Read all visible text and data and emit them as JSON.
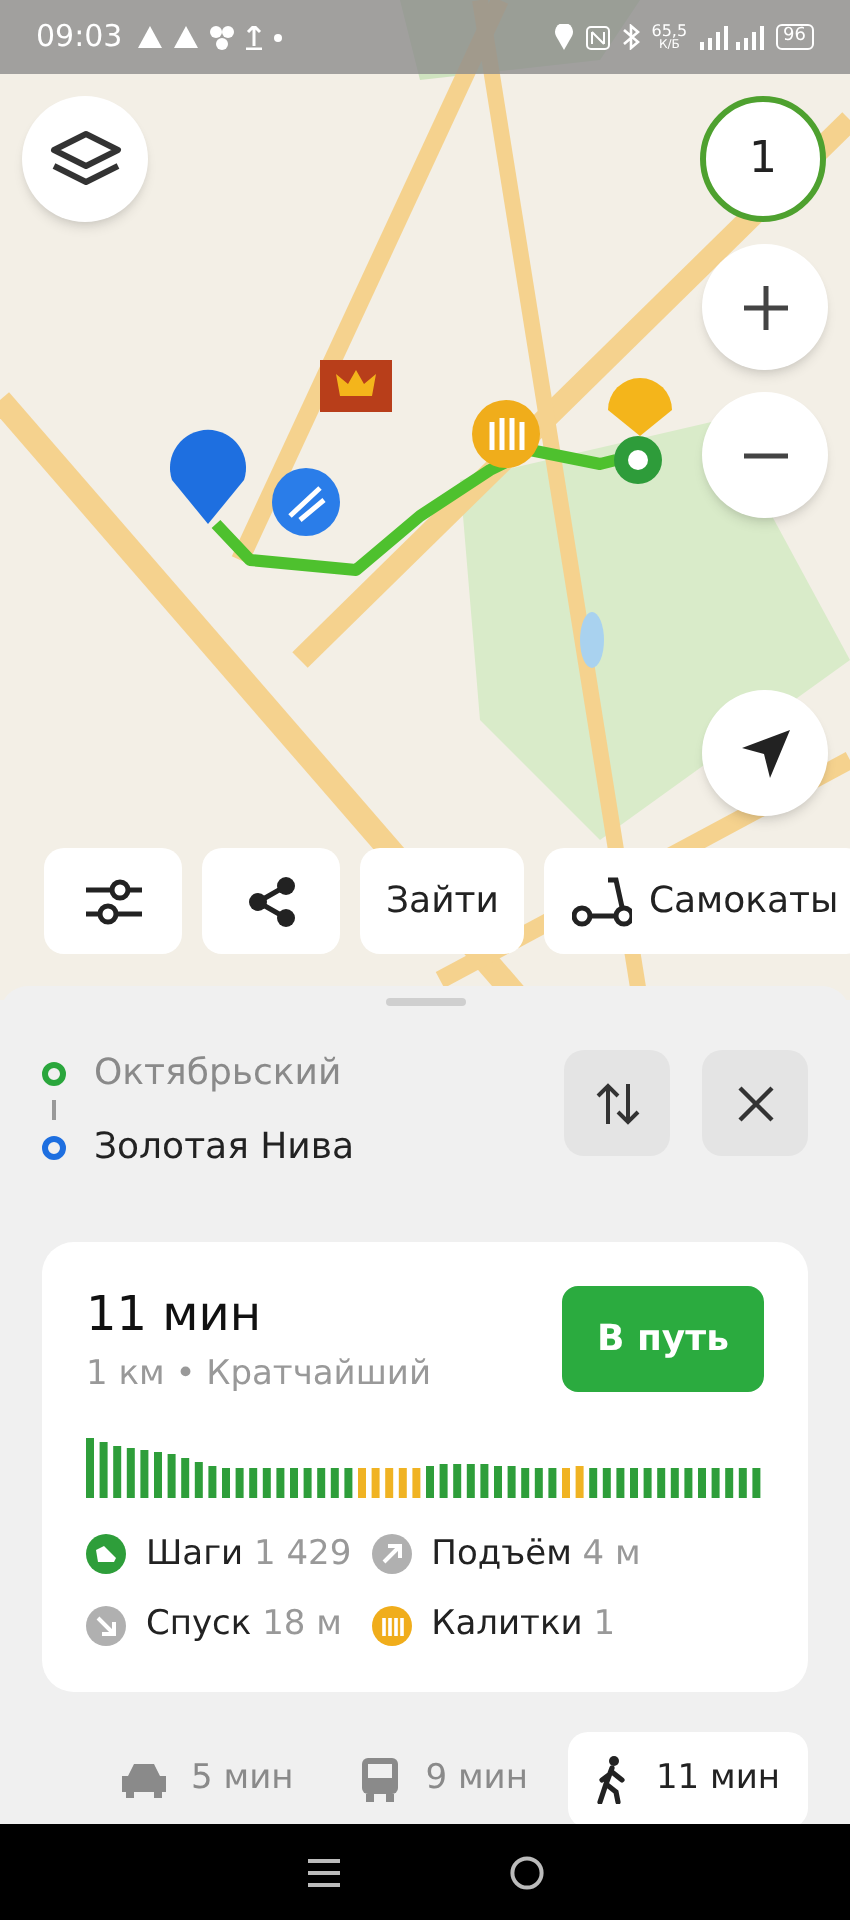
{
  "status_bar": {
    "time": "09:03",
    "net_speed": "65,5",
    "net_speed_unit": "К/Б",
    "battery": "96"
  },
  "map": {
    "counter_button": "1"
  },
  "map_actions": [
    {
      "kind": "filters"
    },
    {
      "kind": "share"
    },
    {
      "kind": "text",
      "label": "Зайти"
    },
    {
      "kind": "scooters",
      "label": "Самокаты"
    }
  ],
  "route": {
    "from": "Октябрьский",
    "to": "Золотая Нива"
  },
  "summary": {
    "duration": "11 мин",
    "details": "1 км • Кратчайший",
    "go_button": "В путь"
  },
  "stats": [
    {
      "kind": "steps",
      "label": "Шаги",
      "value": "1 429"
    },
    {
      "kind": "ascent",
      "label": "Подъём",
      "value": "4 м"
    },
    {
      "kind": "descent",
      "label": "Спуск",
      "value": "18 м"
    },
    {
      "kind": "gates",
      "label": "Калитки",
      "value": "1"
    }
  ],
  "modes": [
    {
      "kind": "car",
      "label": "5 мин",
      "selected": false
    },
    {
      "kind": "bus",
      "label": "9 мин",
      "selected": false
    },
    {
      "kind": "walk",
      "label": "11 мин",
      "selected": true
    }
  ]
}
